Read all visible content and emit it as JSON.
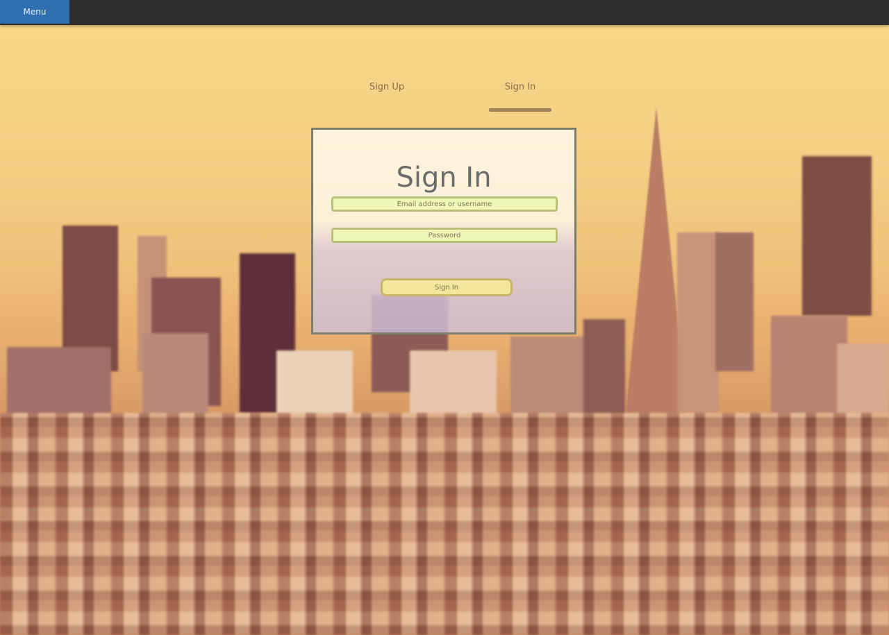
{
  "topbar": {
    "menu_label": "Menu"
  },
  "tabs": {
    "signup_label": "Sign Up",
    "signin_label": "Sign In"
  },
  "card": {
    "title": "Sign In",
    "email_placeholder": "Email address or username",
    "password_placeholder": "Password",
    "submit_label": "Sign In"
  },
  "colors": {
    "topbar_bg": "#2d2d2d",
    "menu_bg": "#2f6fb0",
    "field_bg": "#eef7b6",
    "button_bg": "#f1e69a"
  }
}
